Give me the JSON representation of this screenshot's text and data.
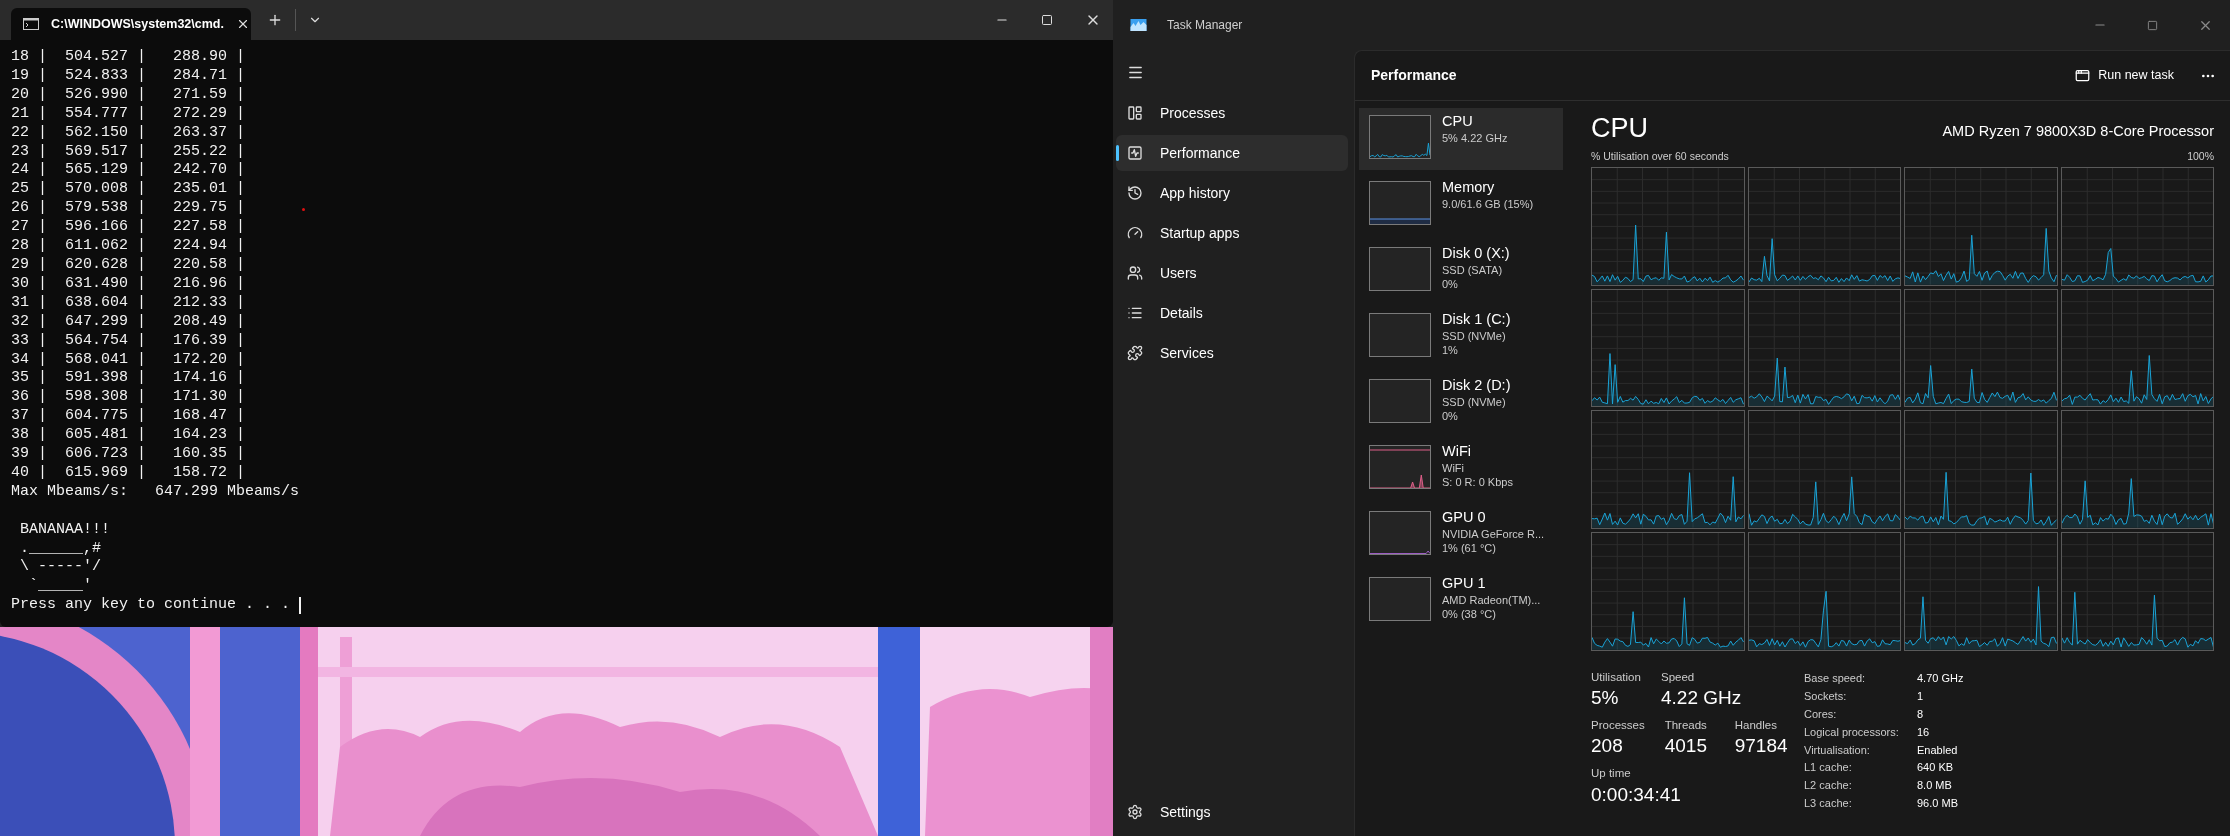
{
  "terminal": {
    "tab_title": "C:\\WINDOWS\\system32\\cmd.",
    "lines": [
      "18 |  504.527 |   288.90 |",
      "19 |  524.833 |   284.71 |",
      "20 |  526.990 |   271.59 |",
      "21 |  554.777 |   272.29 |",
      "22 |  562.150 |   263.37 |",
      "23 |  569.517 |   255.22 |",
      "24 |  565.129 |   242.70 |",
      "25 |  570.008 |   235.01 |",
      "26 |  579.538 |   229.75 |",
      "27 |  596.166 |   227.58 |",
      "28 |  611.062 |   224.94 |",
      "29 |  620.628 |   220.58 |",
      "30 |  631.490 |   216.96 |",
      "31 |  638.604 |   212.33 |",
      "32 |  647.299 |   208.49 |",
      "33 |  564.754 |   176.39 |",
      "34 |  568.041 |   172.20 |",
      "35 |  591.398 |   174.16 |",
      "36 |  598.308 |   171.30 |",
      "37 |  604.775 |   168.47 |",
      "38 |  605.481 |   164.23 |",
      "39 |  606.723 |   160.35 |",
      "40 |  615.969 |   158.72 |",
      "Max Mbeams/s:   647.299 Mbeams/s"
    ],
    "art_lines": [
      " BANANAA!!!",
      " .______,#",
      " \\ -----'/",
      "  `_____'"
    ],
    "prompt": "Press any key to continue . . ."
  },
  "task_manager": {
    "title": "Task Manager",
    "nav": [
      {
        "label": "Processes",
        "selected": false
      },
      {
        "label": "Performance",
        "selected": true
      },
      {
        "label": "App history",
        "selected": false
      },
      {
        "label": "Startup apps",
        "selected": false
      },
      {
        "label": "Users",
        "selected": false
      },
      {
        "label": "Details",
        "selected": false
      },
      {
        "label": "Services",
        "selected": false
      }
    ],
    "settings": "Settings",
    "page_title": "Performance",
    "run_new_task": "Run new task",
    "devices": [
      {
        "kind": "cpu",
        "name": "CPU",
        "lines": [
          "5%  4.22 GHz"
        ],
        "selected": true
      },
      {
        "kind": "memory",
        "name": "Memory",
        "lines": [
          "9.0/61.6 GB (15%)"
        ],
        "selected": false
      },
      {
        "kind": "disk",
        "name": "Disk 0 (X:)",
        "lines": [
          "SSD (SATA)",
          "0%"
        ],
        "selected": false
      },
      {
        "kind": "disk",
        "name": "Disk 1 (C:)",
        "lines": [
          "SSD (NVMe)",
          "1%"
        ],
        "selected": false
      },
      {
        "kind": "disk",
        "name": "Disk 2 (D:)",
        "lines": [
          "SSD (NVMe)",
          "0%"
        ],
        "selected": false
      },
      {
        "kind": "network",
        "name": "WiFi",
        "lines": [
          "WiFi",
          "S: 0 R: 0 Kbps"
        ],
        "selected": false
      },
      {
        "kind": "gpu",
        "name": "GPU 0",
        "lines": [
          "NVIDIA GeForce R...",
          "1%  (61 °C)"
        ],
        "selected": false
      },
      {
        "kind": "gpu_idle",
        "name": "GPU 1",
        "lines": [
          "AMD Radeon(TM)...",
          "0%  (38 °C)"
        ],
        "selected": false
      }
    ],
    "detail": {
      "title": "CPU",
      "model": "AMD Ryzen 7 9800X3D 8-Core Processor",
      "axis_label": "% Utilisation over 60 seconds",
      "axis_max": "100%",
      "stats": [
        [
          {
            "label": "Utilisation",
            "value": "5%"
          },
          {
            "label": "Speed",
            "value": "4.22 GHz"
          }
        ],
        [
          {
            "label": "Processes",
            "value": "208"
          },
          {
            "label": "Threads",
            "value": "4015"
          },
          {
            "label": "Handles",
            "value": "97184"
          }
        ],
        [
          {
            "label": "Up time",
            "value": "0:00:34:41"
          }
        ]
      ],
      "specs": [
        {
          "label": "Base speed:",
          "value": "4.70 GHz"
        },
        {
          "label": "Sockets:",
          "value": "1"
        },
        {
          "label": "Cores:",
          "value": "8"
        },
        {
          "label": "Logical processors:",
          "value": "16"
        },
        {
          "label": "Virtualisation:",
          "value": "Enabled"
        },
        {
          "label": "L1 cache:",
          "value": "640 KB"
        },
        {
          "label": "L2 cache:",
          "value": "8.0 MB"
        },
        {
          "label": "L3 cache:",
          "value": "96.0 MB"
        }
      ]
    }
  }
}
